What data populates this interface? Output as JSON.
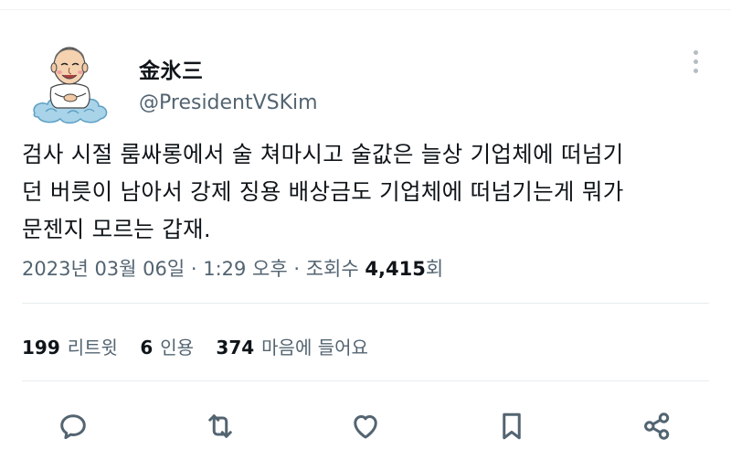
{
  "author": {
    "display_name": "金氷三",
    "handle": "@PresidentVSKim",
    "avatar_icon": "cartoon-old-man-on-cloud-avatar"
  },
  "tweet": {
    "text_lines": [
      "검사 시절 룸싸롱에서 술 쳐마시고 술값은 늘상 기업체에 떠넘기",
      "던 버릇이 남아서 강제 징용 배상금도 기업체에 떠넘기는게 뭐가",
      "문젠지 모르는 갑재."
    ],
    "timestamp": "2023년 03월 06일 · 1:29 오후 ·",
    "views_label": "조회수",
    "views_count": "4,415",
    "views_suffix": "회"
  },
  "stats": {
    "retweets_count": "199",
    "retweets_label": "리트윗",
    "quotes_count": "6",
    "quotes_label": "인용",
    "likes_count": "374",
    "likes_label": "마음에 들어요"
  },
  "actions": {
    "reply": "reply-icon",
    "retweet": "retweet-icon",
    "like": "heart-icon",
    "bookmark": "bookmark-icon",
    "share": "share-icon",
    "more": "more-options-icon"
  },
  "colors": {
    "text": "#0f1419",
    "secondary": "#536471",
    "divider": "#e7ebed"
  }
}
